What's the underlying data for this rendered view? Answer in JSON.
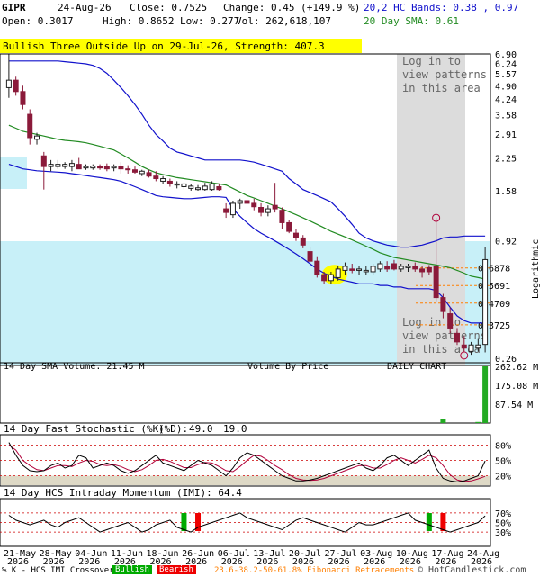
{
  "header": {
    "ticker": "GIPR",
    "date": "24-Aug-26",
    "close": "Close: 0.7525",
    "change": "Change: 0.45 (+149.9 %)",
    "open": "Open: 0.3017",
    "high": "High: 0.8652",
    "low": "Low: 0.277",
    "vol": "Vol: 262,618,107",
    "bands": "20,2 HC Bands: 0.38 , 0.97",
    "sma": "20 Day SMA: 0.61"
  },
  "pattern_banner": "Bullish Three Outside Up on 29-Jul-26, Strength: 407.3",
  "locked_text_lines": [
    "Log in to",
    "view patterns",
    "in this area"
  ],
  "colors": {
    "up_candle": "#1f1f1f",
    "down_candle": "#8b1a3a",
    "upper_band": "#1111cc",
    "lower_band": "#1111cc",
    "sma": "#228b22",
    "volume_by_price": "#c8f0f8",
    "fib": "#ff7f00",
    "pattern_highlight": "#ffff00",
    "locked_area": "#dcdcdc",
    "stoch_k": "#000000",
    "stoch_d": "#b0003a",
    "stoch_band": "#c8c0a0",
    "imi_bull": "#00aa00",
    "imi_bear": "#ee0000",
    "volume_bar": "#22aa22"
  },
  "chart_data": {
    "type": "candlestick",
    "scale": "logarithmic",
    "ylim": [
      0.26,
      6.9
    ],
    "y_ticks": [
      "6.90",
      "6.24",
      "5.57",
      "4.90",
      "4.24",
      "3.58",
      "2.91",
      "2.25",
      "1.58",
      "0.92",
      "0.26"
    ],
    "y_axis_label": "Logarithmic",
    "x_tick_labels": [
      {
        "day": "21-May",
        "year": "2026"
      },
      {
        "day": "28-May",
        "year": "2026"
      },
      {
        "day": "04-Jun",
        "year": "2026"
      },
      {
        "day": "11-Jun",
        "year": "2026"
      },
      {
        "day": "18-Jun",
        "year": "2026"
      },
      {
        "day": "26-Jun",
        "year": "2026"
      },
      {
        "day": "06-Jul",
        "year": "2026"
      },
      {
        "day": "13-Jul",
        "year": "2026"
      },
      {
        "day": "20-Jul",
        "year": "2026"
      },
      {
        "day": "27-Jul",
        "year": "2026"
      },
      {
        "day": "03-Aug",
        "year": "2026"
      },
      {
        "day": "10-Aug",
        "year": "2026"
      },
      {
        "day": "17-Aug",
        "year": "2026"
      },
      {
        "day": "24-Aug",
        "year": "2026"
      }
    ],
    "candles": [
      {
        "o": 4.8,
        "h": 6.9,
        "l": 4.3,
        "c": 5.2
      },
      {
        "o": 5.2,
        "h": 5.4,
        "l": 4.4,
        "c": 4.6
      },
      {
        "o": 4.6,
        "h": 4.9,
        "l": 3.8,
        "c": 4.0
      },
      {
        "o": 3.6,
        "h": 3.8,
        "l": 2.6,
        "c": 2.8
      },
      {
        "o": 2.75,
        "h": 2.95,
        "l": 2.6,
        "c": 2.85
      },
      {
        "o": 2.3,
        "h": 2.4,
        "l": 1.6,
        "c": 2.05
      },
      {
        "o": 2.05,
        "h": 2.2,
        "l": 1.95,
        "c": 2.1
      },
      {
        "o": 2.05,
        "h": 2.2,
        "l": 2.0,
        "c": 2.1
      },
      {
        "o": 2.05,
        "h": 2.15,
        "l": 2.0,
        "c": 2.1
      },
      {
        "o": 2.05,
        "h": 2.2,
        "l": 1.95,
        "c": 2.12
      },
      {
        "o": 2.1,
        "h": 2.25,
        "l": 2.0,
        "c": 2.0
      },
      {
        "o": 2.02,
        "h": 2.1,
        "l": 1.98,
        "c": 2.05
      },
      {
        "o": 2.02,
        "h": 2.1,
        "l": 1.98,
        "c": 2.06
      },
      {
        "o": 2.05,
        "h": 2.1,
        "l": 1.98,
        "c": 2.02
      },
      {
        "o": 2.05,
        "h": 2.12,
        "l": 1.95,
        "c": 2.0
      },
      {
        "o": 2.02,
        "h": 2.1,
        "l": 1.95,
        "c": 2.05
      },
      {
        "o": 2.05,
        "h": 2.15,
        "l": 1.9,
        "c": 2.0
      },
      {
        "o": 2.0,
        "h": 2.08,
        "l": 1.9,
        "c": 1.98
      },
      {
        "o": 1.98,
        "h": 2.05,
        "l": 1.9,
        "c": 1.93
      },
      {
        "o": 1.9,
        "h": 1.98,
        "l": 1.85,
        "c": 1.95
      },
      {
        "o": 1.92,
        "h": 1.98,
        "l": 1.82,
        "c": 1.85
      },
      {
        "o": 1.85,
        "h": 1.95,
        "l": 1.75,
        "c": 1.8
      },
      {
        "o": 1.75,
        "h": 1.85,
        "l": 1.7,
        "c": 1.8
      },
      {
        "o": 1.75,
        "h": 1.8,
        "l": 1.65,
        "c": 1.7
      },
      {
        "o": 1.68,
        "h": 1.75,
        "l": 1.62,
        "c": 1.7
      },
      {
        "o": 1.65,
        "h": 1.72,
        "l": 1.6,
        "c": 1.7
      },
      {
        "o": 1.62,
        "h": 1.7,
        "l": 1.58,
        "c": 1.66
      },
      {
        "o": 1.6,
        "h": 1.68,
        "l": 1.58,
        "c": 1.63
      },
      {
        "o": 1.6,
        "h": 1.72,
        "l": 1.58,
        "c": 1.66
      },
      {
        "o": 1.6,
        "h": 1.75,
        "l": 1.58,
        "c": 1.7
      },
      {
        "o": 1.65,
        "h": 1.7,
        "l": 1.58,
        "c": 1.6
      },
      {
        "o": 1.3,
        "h": 1.38,
        "l": 1.18,
        "c": 1.25
      },
      {
        "o": 1.22,
        "h": 1.42,
        "l": 1.18,
        "c": 1.38
      },
      {
        "o": 1.38,
        "h": 1.45,
        "l": 1.3,
        "c": 1.42
      },
      {
        "o": 1.42,
        "h": 1.48,
        "l": 1.35,
        "c": 1.38
      },
      {
        "o": 1.38,
        "h": 1.45,
        "l": 1.28,
        "c": 1.33
      },
      {
        "o": 1.32,
        "h": 1.38,
        "l": 1.2,
        "c": 1.25
      },
      {
        "o": 1.25,
        "h": 1.35,
        "l": 1.2,
        "c": 1.3
      },
      {
        "o": 1.35,
        "h": 1.72,
        "l": 1.25,
        "c": 1.3
      },
      {
        "o": 1.28,
        "h": 1.32,
        "l": 1.05,
        "c": 1.12
      },
      {
        "o": 1.12,
        "h": 1.15,
        "l": 1.0,
        "c": 1.02
      },
      {
        "o": 1.0,
        "h": 1.05,
        "l": 0.92,
        "c": 0.95
      },
      {
        "o": 0.95,
        "h": 0.98,
        "l": 0.85,
        "c": 0.88
      },
      {
        "o": 0.82,
        "h": 0.86,
        "l": 0.7,
        "c": 0.74
      },
      {
        "o": 0.74,
        "h": 0.78,
        "l": 0.62,
        "c": 0.64
      },
      {
        "o": 0.64,
        "h": 0.66,
        "l": 0.58,
        "c": 0.6
      },
      {
        "o": 0.6,
        "h": 0.66,
        "l": 0.58,
        "c": 0.64
      },
      {
        "o": 0.62,
        "h": 0.7,
        "l": 0.6,
        "c": 0.68
      },
      {
        "o": 0.67,
        "h": 0.73,
        "l": 0.64,
        "c": 0.7
      },
      {
        "o": 0.68,
        "h": 0.72,
        "l": 0.65,
        "c": 0.67
      },
      {
        "o": 0.67,
        "h": 0.7,
        "l": 0.64,
        "c": 0.68
      },
      {
        "o": 0.66,
        "h": 0.7,
        "l": 0.64,
        "c": 0.67
      },
      {
        "o": 0.66,
        "h": 0.72,
        "l": 0.64,
        "c": 0.7
      },
      {
        "o": 0.68,
        "h": 0.74,
        "l": 0.66,
        "c": 0.72
      },
      {
        "o": 0.7,
        "h": 0.74,
        "l": 0.66,
        "c": 0.68
      },
      {
        "o": 0.72,
        "h": 0.75,
        "l": 0.67,
        "c": 0.68
      },
      {
        "o": 0.68,
        "h": 0.72,
        "l": 0.66,
        "c": 0.7
      },
      {
        "o": 0.69,
        "h": 0.72,
        "l": 0.66,
        "c": 0.7
      },
      {
        "o": 0.7,
        "h": 0.73,
        "l": 0.66,
        "c": 0.68
      },
      {
        "o": 0.68,
        "h": 0.7,
        "l": 0.62,
        "c": 0.66
      },
      {
        "o": 0.69,
        "h": 0.71,
        "l": 0.64,
        "c": 0.66
      },
      {
        "o": 0.7,
        "h": 1.18,
        "l": 0.48,
        "c": 0.5
      },
      {
        "o": 0.5,
        "h": 0.52,
        "l": 0.4,
        "c": 0.43
      },
      {
        "o": 0.42,
        "h": 0.45,
        "l": 0.34,
        "c": 0.36
      },
      {
        "o": 0.34,
        "h": 0.36,
        "l": 0.3,
        "c": 0.31
      },
      {
        "o": 0.3,
        "h": 0.33,
        "l": 0.28,
        "c": 0.29
      },
      {
        "o": 0.28,
        "h": 0.31,
        "l": 0.27,
        "c": 0.3
      },
      {
        "o": 0.29,
        "h": 0.32,
        "l": 0.28,
        "c": 0.3
      },
      {
        "o": 0.3017,
        "h": 0.8652,
        "l": 0.277,
        "c": 0.7525
      }
    ],
    "upper_band": [
      6.4,
      6.4,
      6.4,
      6.4,
      6.4,
      6.4,
      6.4,
      6.4,
      6.35,
      6.3,
      6.25,
      6.2,
      6.1,
      5.9,
      5.6,
      5.2,
      4.8,
      4.4,
      4.0,
      3.6,
      3.2,
      2.9,
      2.7,
      2.5,
      2.4,
      2.35,
      2.3,
      2.25,
      2.2,
      2.2,
      2.2,
      2.2,
      2.2,
      2.2,
      2.18,
      2.15,
      2.1,
      2.05,
      2.0,
      1.95,
      1.8,
      1.7,
      1.6,
      1.55,
      1.5,
      1.45,
      1.4,
      1.3,
      1.2,
      1.1,
      1.0,
      0.95,
      0.92,
      0.9,
      0.88,
      0.87,
      0.86,
      0.86,
      0.87,
      0.88,
      0.9,
      0.92,
      0.95,
      0.96,
      0.96,
      0.97,
      0.97,
      0.97,
      0.97
    ],
    "sma": [
      3.2,
      3.1,
      3.0,
      2.95,
      2.9,
      2.85,
      2.8,
      2.75,
      2.72,
      2.7,
      2.68,
      2.65,
      2.6,
      2.55,
      2.5,
      2.45,
      2.35,
      2.25,
      2.15,
      2.05,
      1.98,
      1.92,
      1.88,
      1.85,
      1.82,
      1.8,
      1.78,
      1.76,
      1.74,
      1.72,
      1.7,
      1.68,
      1.62,
      1.56,
      1.5,
      1.46,
      1.42,
      1.38,
      1.34,
      1.3,
      1.26,
      1.22,
      1.18,
      1.14,
      1.1,
      1.06,
      1.02,
      0.99,
      0.96,
      0.93,
      0.9,
      0.87,
      0.84,
      0.81,
      0.79,
      0.77,
      0.76,
      0.75,
      0.74,
      0.73,
      0.72,
      0.71,
      0.7,
      0.69,
      0.67,
      0.65,
      0.63,
      0.62,
      0.61
    ],
    "lower_band": [
      2.1,
      2.05,
      2.0,
      1.98,
      1.96,
      1.95,
      1.94,
      1.93,
      1.92,
      1.9,
      1.88,
      1.86,
      1.84,
      1.82,
      1.8,
      1.78,
      1.75,
      1.7,
      1.65,
      1.6,
      1.55,
      1.5,
      1.48,
      1.47,
      1.46,
      1.45,
      1.45,
      1.46,
      1.47,
      1.48,
      1.48,
      1.47,
      1.3,
      1.2,
      1.12,
      1.05,
      1.0,
      0.96,
      0.92,
      0.88,
      0.84,
      0.8,
      0.76,
      0.72,
      0.68,
      0.65,
      0.63,
      0.61,
      0.6,
      0.59,
      0.58,
      0.58,
      0.58,
      0.57,
      0.57,
      0.56,
      0.56,
      0.55,
      0.55,
      0.55,
      0.55,
      0.54,
      0.5,
      0.45,
      0.41,
      0.39,
      0.38,
      0.38,
      0.38
    ],
    "fib_levels": [
      {
        "label": "0.6878",
        "value": 0.6878
      },
      {
        "label": "0.5691",
        "value": 0.5691
      },
      {
        "label": "0.4709",
        "value": 0.4709
      },
      {
        "label": "0.3725",
        "value": 0.3725
      }
    ],
    "volume_panel": {
      "title": "14 Day SMA Volume: 21.45 M",
      "subtitle_mid": "Volume By Price",
      "subtitle_right": "DAILY CHART",
      "y_ticks": [
        "262.62 M",
        "175.08 M",
        "87.54 M"
      ],
      "max": 262.62,
      "values": [
        2,
        1,
        1,
        1,
        1,
        1,
        1,
        1,
        1,
        1,
        1,
        1,
        1,
        1,
        1,
        1,
        1,
        1,
        1,
        1,
        1,
        1,
        1,
        1,
        1,
        1,
        1,
        1,
        1,
        1,
        1,
        1,
        1,
        1,
        1,
        1,
        1,
        1,
        1,
        1,
        1,
        1,
        1,
        1,
        1,
        1,
        1,
        1,
        1,
        1,
        1,
        1,
        1,
        1,
        1,
        1,
        1,
        1,
        1,
        1,
        1,
        1,
        18,
        2,
        1,
        1,
        1,
        5,
        262.62
      ]
    },
    "stoch_panel": {
      "title_prefix": "14 Day Fast Stochastic (%K)",
      "d_label": "(%D):",
      "k_value": "49.0",
      "d_value": "19.0",
      "y_ticks": [
        "80%",
        "50%",
        "20%"
      ],
      "k": [
        85,
        60,
        40,
        30,
        28,
        30,
        40,
        45,
        35,
        40,
        60,
        55,
        35,
        40,
        45,
        40,
        30,
        25,
        30,
        40,
        50,
        60,
        45,
        40,
        35,
        30,
        40,
        50,
        45,
        40,
        30,
        20,
        35,
        55,
        65,
        60,
        50,
        40,
        30,
        20,
        15,
        10,
        10,
        12,
        15,
        20,
        25,
        30,
        35,
        40,
        45,
        35,
        30,
        40,
        55,
        60,
        50,
        40,
        50,
        60,
        70,
        35,
        15,
        10,
        8,
        10,
        15,
        20,
        49
      ],
      "d": [
        80,
        70,
        50,
        40,
        32,
        30,
        35,
        40,
        40,
        38,
        45,
        50,
        48,
        42,
        40,
        42,
        38,
        32,
        28,
        32,
        40,
        50,
        52,
        48,
        42,
        36,
        36,
        42,
        46,
        45,
        38,
        30,
        28,
        38,
        50,
        60,
        58,
        50,
        40,
        32,
        22,
        15,
        12,
        11,
        12,
        15,
        20,
        25,
        30,
        35,
        40,
        40,
        35,
        35,
        42,
        50,
        55,
        50,
        45,
        52,
        60,
        55,
        40,
        22,
        12,
        9,
        10,
        14,
        19
      ]
    },
    "imi_panel": {
      "title": "14 Day HCS Intraday Momentum (IMI): 64.4",
      "y_ticks": [
        "70%",
        "50%",
        "30%"
      ],
      "values": [
        65,
        55,
        50,
        45,
        50,
        55,
        45,
        40,
        50,
        55,
        60,
        50,
        40,
        30,
        35,
        40,
        45,
        50,
        40,
        30,
        35,
        45,
        50,
        55,
        40,
        35,
        30,
        40,
        45,
        50,
        55,
        60,
        65,
        70,
        60,
        55,
        50,
        45,
        40,
        35,
        45,
        55,
        60,
        55,
        50,
        45,
        40,
        35,
        30,
        40,
        50,
        45,
        45,
        50,
        55,
        60,
        65,
        70,
        55,
        50,
        45,
        40,
        35,
        30,
        35,
        40,
        45,
        50,
        64
      ],
      "bull_markers": [
        25,
        60
      ],
      "bear_markers": [
        27,
        62
      ]
    },
    "legend": {
      "prefix": "% K - HCS IMI Crossover:",
      "bullish": "Bullish",
      "bearish": "Bearish",
      "fib": "23.6-38.2-50-61.8% Fibonacci Retracements",
      "copyright": "© HotCandlestick.com"
    }
  }
}
